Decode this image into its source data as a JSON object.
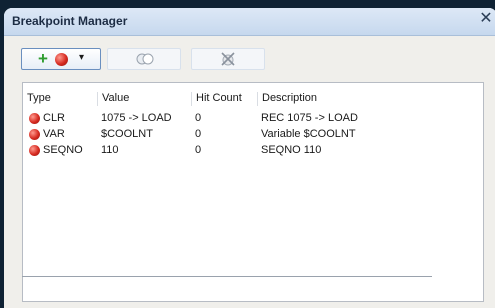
{
  "window": {
    "title": "Breakpoint Manager",
    "close_glyph": "✕"
  },
  "toolbar": {
    "plus_glyph": "+",
    "caret_glyph": "▾"
  },
  "table": {
    "headers": [
      "Type",
      "Value",
      "Hit Count",
      "Description"
    ],
    "rows": [
      {
        "type": "CLR",
        "value": "1075 -> LOAD",
        "hits": "0",
        "description": "REC 1075 -> LOAD"
      },
      {
        "type": "VAR",
        "value": "$COOLNT",
        "hits": "0",
        "description": "Variable $COOLNT"
      },
      {
        "type": "SEQNO",
        "value": "110",
        "hits": "0",
        "description": "SEQNO 110"
      }
    ]
  },
  "icons": {
    "add": "plus-icon",
    "breakpoint": "breakpoint-icon",
    "dropdown": "chevron-down-icon",
    "toggle": "toggle-breakpoint-icon",
    "delete": "delete-breakpoint-icon",
    "close": "close-icon"
  }
}
